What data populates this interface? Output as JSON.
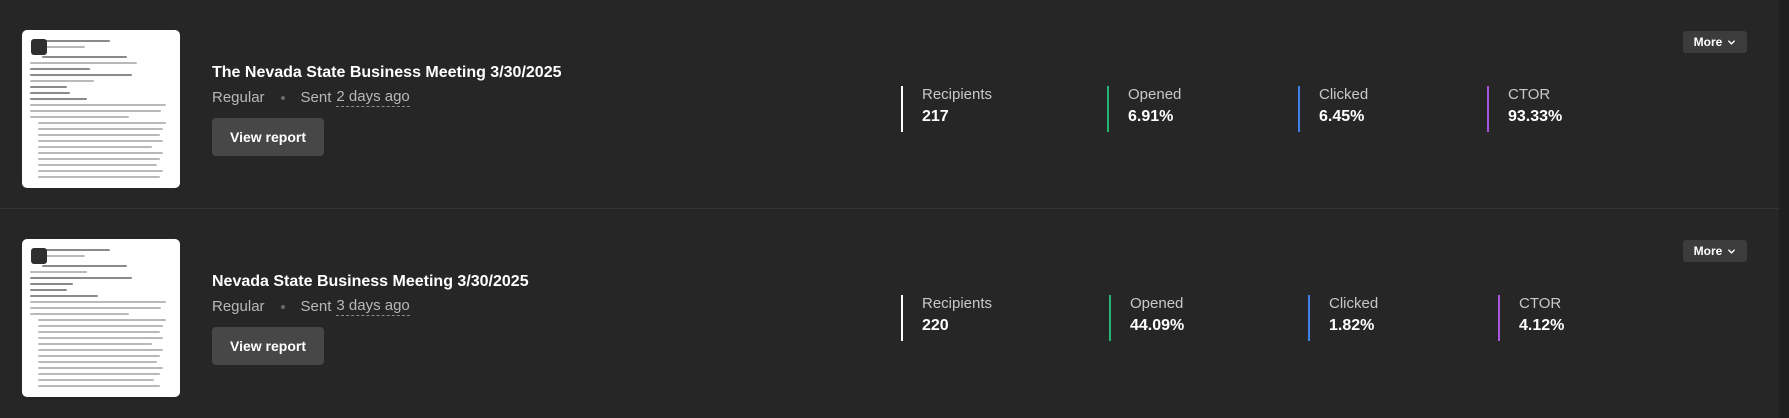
{
  "campaigns": [
    {
      "title": "The Nevada State Business Meeting 3/30/2025",
      "type": "Regular",
      "sent_label": "Sent",
      "sent_when": "2 days ago",
      "view_report_label": "View report",
      "more_label": "More",
      "stats": [
        {
          "label": "Recipients",
          "value": "217",
          "color": "#ffffff"
        },
        {
          "label": "Opened",
          "value": "6.91%",
          "color": "#22b573"
        },
        {
          "label": "Clicked",
          "value": "6.45%",
          "color": "#3f7fe8"
        },
        {
          "label": "CTOR",
          "value": "93.33%",
          "color": "#a855e0"
        }
      ]
    },
    {
      "title": "Nevada State Business Meeting 3/30/2025",
      "type": "Regular",
      "sent_label": "Sent",
      "sent_when": "3 days ago",
      "view_report_label": "View report",
      "more_label": "More",
      "stats": [
        {
          "label": "Recipients",
          "value": "220",
          "color": "#ffffff"
        },
        {
          "label": "Opened",
          "value": "44.09%",
          "color": "#22b573"
        },
        {
          "label": "Clicked",
          "value": "1.82%",
          "color": "#3f7fe8"
        },
        {
          "label": "CTOR",
          "value": "4.12%",
          "color": "#a855e0"
        }
      ]
    }
  ]
}
